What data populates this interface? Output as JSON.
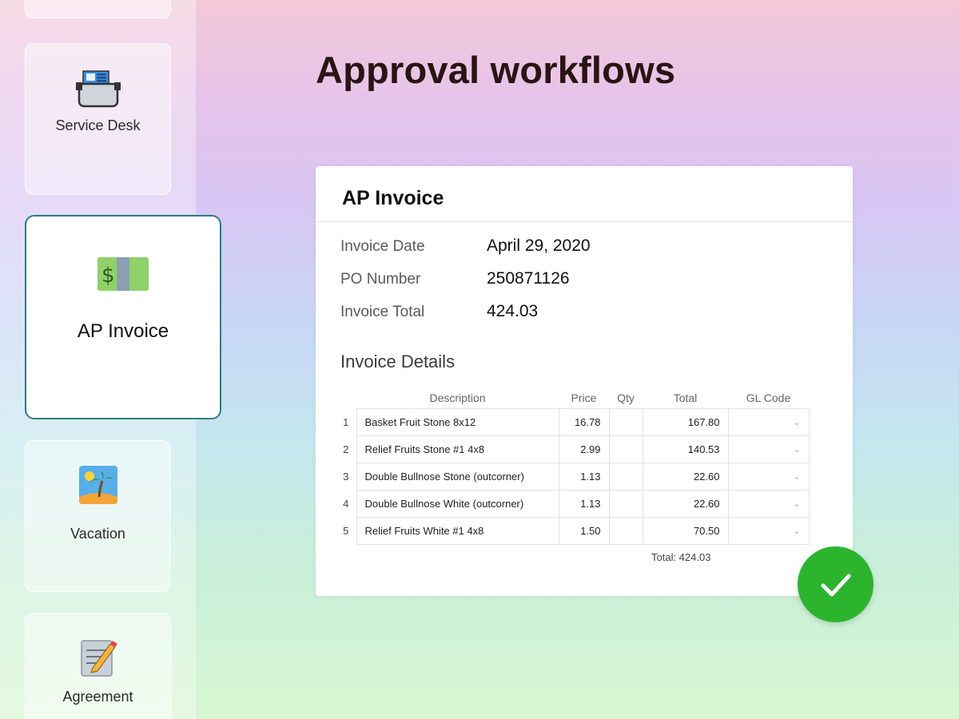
{
  "page": {
    "title": "Approval workflows"
  },
  "sidebar": {
    "items": [
      {
        "label": "Service Desk",
        "icon": "service-desk-icon"
      },
      {
        "label": "AP Invoice",
        "icon": "money-icon",
        "active": true
      },
      {
        "label": "Vacation",
        "icon": "island-icon"
      },
      {
        "label": "Agreement",
        "icon": "memo-pencil-icon"
      }
    ]
  },
  "invoice": {
    "title": "AP Invoice",
    "fields": [
      {
        "label": "Invoice Date",
        "value": "April 29, 2020"
      },
      {
        "label": "PO Number",
        "value": "250871126"
      },
      {
        "label": "Invoice Total",
        "value": "424.03"
      }
    ],
    "details_title": "Invoice Details",
    "columns": [
      "Description",
      "Price",
      "Qty",
      "Total",
      "GL Code"
    ],
    "rows": [
      {
        "n": "1",
        "description": "Basket Fruit Stone 8x12",
        "price": "16.78",
        "qty": "",
        "total": "167.80"
      },
      {
        "n": "2",
        "description": "Relief Fruits Stone #1 4x8",
        "price": "2.99",
        "qty": "",
        "total": "140.53"
      },
      {
        "n": "3",
        "description": "Double Bullnose Stone (outcorner)",
        "price": "1.13",
        "qty": "",
        "total": "22.60"
      },
      {
        "n": "4",
        "description": "Double Bullnose White (outcorner)",
        "price": "1.13",
        "qty": "",
        "total": "22.60"
      },
      {
        "n": "5",
        "description": "Relief Fruits White #1 4x8",
        "price": "1.50",
        "qty": "",
        "total": "70.50"
      }
    ],
    "total_line": "Total: 424.03"
  },
  "colors": {
    "accent_border": "#2f7c82",
    "approve_green": "#2db42f"
  }
}
